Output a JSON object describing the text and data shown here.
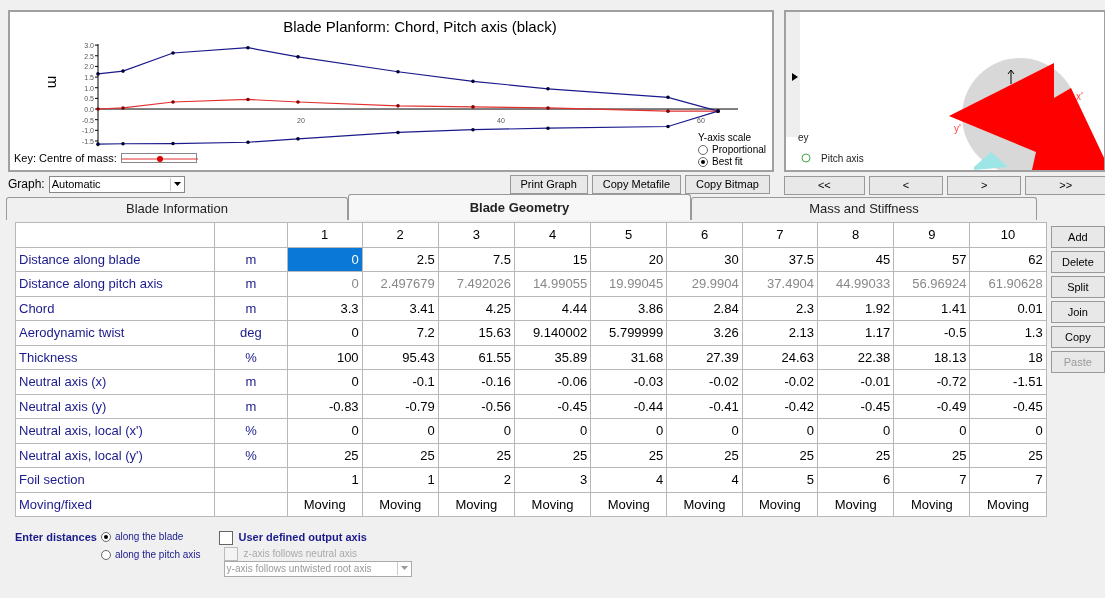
{
  "planform": {
    "title": "Blade Planform: Chord, Pitch axis (black)",
    "key_label": "Key: Centre of mass:",
    "scale": {
      "label": "Y-axis scale",
      "options": [
        {
          "label": "Proportional",
          "selected": false
        },
        {
          "label": "Best fit",
          "selected": true
        }
      ]
    },
    "chart_data": {
      "type": "line",
      "ylabel": "m",
      "x": [
        0,
        2.5,
        7.5,
        15,
        20,
        30,
        37.5,
        45,
        57,
        62
      ],
      "xticks": [
        20,
        40,
        60
      ],
      "yticks": [
        {
          "value": -1.5,
          "label": "-1.5"
        },
        {
          "value": -1,
          "label": "-1.0"
        },
        {
          "value": -0.5,
          "label": "-0.5"
        },
        {
          "value": 0,
          "label": "0.0"
        },
        {
          "value": 0.5,
          "label": "0.5"
        },
        {
          "value": 1,
          "label": "1.0"
        },
        {
          "value": 1.5,
          "label": "1.5"
        },
        {
          "value": 2,
          "label": "2.0"
        },
        {
          "value": 2.5,
          "label": "2.5"
        },
        {
          "value": 3,
          "label": "3.0"
        }
      ],
      "xlim": [
        0,
        64
      ],
      "ylim": [
        -1.75,
        3.05
      ],
      "series": [
        {
          "color": "#1a1a8c",
          "values": [
            1.65,
            1.78,
            2.63,
            2.88,
            2.45,
            1.75,
            1.3,
            0.95,
            0.55,
            -0.1
          ]
        },
        {
          "color": "#e03030",
          "values": [
            0.0,
            0.05,
            0.33,
            0.45,
            0.33,
            0.15,
            0.1,
            0.05,
            -0.1,
            -0.1
          ]
        },
        {
          "color": "#1a1a8c",
          "values": [
            -1.65,
            -1.63,
            -1.62,
            -1.56,
            -1.4,
            -1.1,
            -0.97,
            -0.9,
            -0.82,
            -0.1
          ]
        }
      ]
    }
  },
  "graph_select": {
    "label": "Graph:",
    "value": "Automatic"
  },
  "graph_buttons": [
    "Print Graph",
    "Copy Metafile",
    "Copy Bitmap"
  ],
  "section_view": {
    "key_label": "ey",
    "legend": "Pitch axis",
    "axis_labels": [
      "x'",
      "y'"
    ]
  },
  "nav_buttons": [
    "<<",
    "<",
    ">",
    ">>"
  ],
  "tabs": [
    {
      "label": "Blade Information",
      "selected": false
    },
    {
      "label": "Blade Geometry",
      "selected": true
    },
    {
      "label": "Mass and Stiffness",
      "selected": false
    }
  ],
  "table": {
    "columns": [
      "1",
      "2",
      "3",
      "4",
      "5",
      "6",
      "7",
      "8",
      "9",
      "10"
    ],
    "rows": [
      {
        "label": "Distance along blade",
        "unit": "m",
        "disabled": false,
        "kind": "number",
        "cells": [
          {
            "v": "0",
            "selected": true
          },
          {
            "v": "2.5",
            "selected": false
          },
          {
            "v": "7.5",
            "selected": false
          },
          {
            "v": "15",
            "selected": false
          },
          {
            "v": "20",
            "selected": false
          },
          {
            "v": "30",
            "selected": false
          },
          {
            "v": "37.5",
            "selected": false
          },
          {
            "v": "45",
            "selected": false
          },
          {
            "v": "57",
            "selected": false
          },
          {
            "v": "62",
            "selected": false
          }
        ]
      },
      {
        "label": "Distance along pitch axis",
        "unit": "m",
        "disabled": true,
        "kind": "number",
        "cells": [
          {
            "v": "0",
            "selected": false
          },
          {
            "v": "2.497679",
            "selected": false
          },
          {
            "v": "7.492026",
            "selected": false
          },
          {
            "v": "14.99055",
            "selected": false
          },
          {
            "v": "19.99045",
            "selected": false
          },
          {
            "v": "29.9904",
            "selected": false
          },
          {
            "v": "37.4904",
            "selected": false
          },
          {
            "v": "44.99033",
            "selected": false
          },
          {
            "v": "56.96924",
            "selected": false
          },
          {
            "v": "61.90628",
            "selected": false
          }
        ]
      },
      {
        "label": "Chord",
        "unit": "m",
        "disabled": false,
        "kind": "number",
        "cells": [
          {
            "v": "3.3",
            "selected": false
          },
          {
            "v": "3.41",
            "selected": false
          },
          {
            "v": "4.25",
            "selected": false
          },
          {
            "v": "4.44",
            "selected": false
          },
          {
            "v": "3.86",
            "selected": false
          },
          {
            "v": "2.84",
            "selected": false
          },
          {
            "v": "2.3",
            "selected": false
          },
          {
            "v": "1.92",
            "selected": false
          },
          {
            "v": "1.41",
            "selected": false
          },
          {
            "v": "0.01",
            "selected": false
          }
        ]
      },
      {
        "label": "Aerodynamic twist",
        "unit": "deg",
        "disabled": false,
        "kind": "number",
        "cells": [
          {
            "v": "0",
            "selected": false
          },
          {
            "v": "7.2",
            "selected": false
          },
          {
            "v": "15.63",
            "selected": false
          },
          {
            "v": "9.140002",
            "selected": false
          },
          {
            "v": "5.799999",
            "selected": false
          },
          {
            "v": "3.26",
            "selected": false
          },
          {
            "v": "2.13",
            "selected": false
          },
          {
            "v": "1.17",
            "selected": false
          },
          {
            "v": "-0.5",
            "selected": false
          },
          {
            "v": "1.3",
            "selected": false
          }
        ]
      },
      {
        "label": "Thickness",
        "unit": "%",
        "disabled": false,
        "kind": "number",
        "cells": [
          {
            "v": "100",
            "selected": false
          },
          {
            "v": "95.43",
            "selected": false
          },
          {
            "v": "61.55",
            "selected": false
          },
          {
            "v": "35.89",
            "selected": false
          },
          {
            "v": "31.68",
            "selected": false
          },
          {
            "v": "27.39",
            "selected": false
          },
          {
            "v": "24.63",
            "selected": false
          },
          {
            "v": "22.38",
            "selected": false
          },
          {
            "v": "18.13",
            "selected": false
          },
          {
            "v": "18",
            "selected": false
          }
        ]
      },
      {
        "label": "Neutral axis (x)",
        "unit": "m",
        "disabled": false,
        "kind": "number",
        "cells": [
          {
            "v": "0",
            "selected": false
          },
          {
            "v": "-0.1",
            "selected": false
          },
          {
            "v": "-0.16",
            "selected": false
          },
          {
            "v": "-0.06",
            "selected": false
          },
          {
            "v": "-0.03",
            "selected": false
          },
          {
            "v": "-0.02",
            "selected": false
          },
          {
            "v": "-0.02",
            "selected": false
          },
          {
            "v": "-0.01",
            "selected": false
          },
          {
            "v": "-0.72",
            "selected": false
          },
          {
            "v": "-1.51",
            "selected": false
          }
        ]
      },
      {
        "label": "Neutral axis (y)",
        "unit": "m",
        "disabled": false,
        "kind": "number",
        "cells": [
          {
            "v": "-0.83",
            "selected": false
          },
          {
            "v": "-0.79",
            "selected": false
          },
          {
            "v": "-0.56",
            "selected": false
          },
          {
            "v": "-0.45",
            "selected": false
          },
          {
            "v": "-0.44",
            "selected": false
          },
          {
            "v": "-0.41",
            "selected": false
          },
          {
            "v": "-0.42",
            "selected": false
          },
          {
            "v": "-0.45",
            "selected": false
          },
          {
            "v": "-0.49",
            "selected": false
          },
          {
            "v": "-0.45",
            "selected": false
          }
        ]
      },
      {
        "label": "Neutral axis, local (x')",
        "unit": "%",
        "disabled": false,
        "kind": "number",
        "cells": [
          {
            "v": "0",
            "selected": false
          },
          {
            "v": "0",
            "selected": false
          },
          {
            "v": "0",
            "selected": false
          },
          {
            "v": "0",
            "selected": false
          },
          {
            "v": "0",
            "selected": false
          },
          {
            "v": "0",
            "selected": false
          },
          {
            "v": "0",
            "selected": false
          },
          {
            "v": "0",
            "selected": false
          },
          {
            "v": "0",
            "selected": false
          },
          {
            "v": "0",
            "selected": false
          }
        ]
      },
      {
        "label": "Neutral axis, local (y')",
        "unit": "%",
        "disabled": false,
        "kind": "number",
        "cells": [
          {
            "v": "25",
            "selected": false
          },
          {
            "v": "25",
            "selected": false
          },
          {
            "v": "25",
            "selected": false
          },
          {
            "v": "25",
            "selected": false
          },
          {
            "v": "25",
            "selected": false
          },
          {
            "v": "25",
            "selected": false
          },
          {
            "v": "25",
            "selected": false
          },
          {
            "v": "25",
            "selected": false
          },
          {
            "v": "25",
            "selected": false
          },
          {
            "v": "25",
            "selected": false
          }
        ]
      },
      {
        "label": "Foil section",
        "disabled": false,
        "kind": "number",
        "cells": [
          {
            "v": "1",
            "selected": false
          },
          {
            "v": "1",
            "selected": false
          },
          {
            "v": "2",
            "selected": false
          },
          {
            "v": "3",
            "selected": false
          },
          {
            "v": "4",
            "selected": false
          },
          {
            "v": "4",
            "selected": false
          },
          {
            "v": "5",
            "selected": false
          },
          {
            "v": "6",
            "selected": false
          },
          {
            "v": "7",
            "selected": false
          },
          {
            "v": "7",
            "selected": false
          }
        ]
      },
      {
        "label": "Moving/fixed",
        "disabled": false,
        "kind": "choice",
        "cells": [
          {
            "v": "Moving",
            "selected": false
          },
          {
            "v": "Moving",
            "selected": false
          },
          {
            "v": "Moving",
            "selected": false
          },
          {
            "v": "Moving",
            "selected": false
          },
          {
            "v": "Moving",
            "selected": false
          },
          {
            "v": "Moving",
            "selected": false
          },
          {
            "v": "Moving",
            "selected": false
          },
          {
            "v": "Moving",
            "selected": false
          },
          {
            "v": "Moving",
            "selected": false
          },
          {
            "v": "Moving",
            "selected": false
          }
        ]
      }
    ]
  },
  "actions": [
    {
      "label": "Add",
      "disabled": false
    },
    {
      "label": "Delete",
      "disabled": false
    },
    {
      "label": "Split",
      "disabled": false
    },
    {
      "label": "Join",
      "disabled": false
    },
    {
      "label": "Copy",
      "disabled": false
    },
    {
      "label": "Paste",
      "disabled": true
    }
  ],
  "enter_distances": {
    "label": "Enter distances",
    "options": [
      {
        "label": "along the blade",
        "selected": true
      },
      {
        "label": "along the pitch axis",
        "selected": false
      }
    ]
  },
  "output_axis": {
    "label": "User defined output axis",
    "checked": false,
    "z_follow": {
      "label": "z-axis follows neutral axis",
      "checked": false,
      "disabled": true
    },
    "y_select": {
      "value": "y-axis follows untwisted root axis",
      "disabled": true
    }
  }
}
